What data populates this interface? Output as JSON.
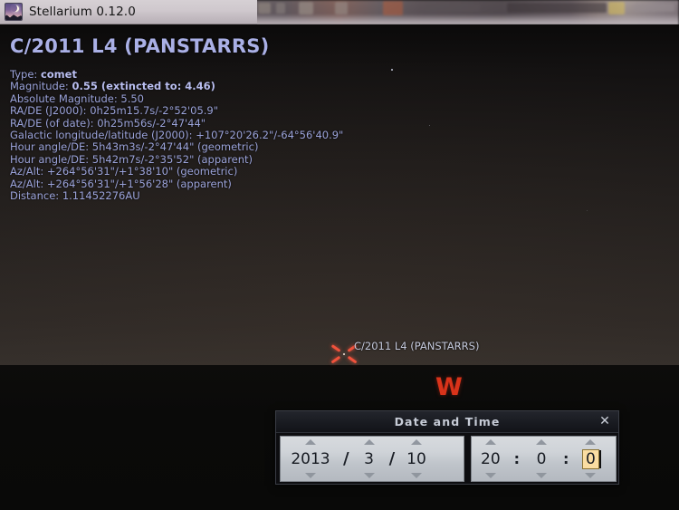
{
  "window": {
    "title": "Stellarium 0.12.0",
    "icon": "stellarium-moon-icon"
  },
  "info_panel": {
    "object_name": "C/2011 L4 (PANSTARRS)",
    "lines": [
      {
        "label": "Type:",
        "value": "comet"
      },
      {
        "label": "Magnitude:",
        "value": "0.55 (extincted to: 4.46)"
      },
      {
        "label": "Absolute Magnitude:",
        "value": "5.50"
      },
      {
        "label": "RA/DE (J2000):",
        "value": "0h25m15.7s/-2°52'05.9\""
      },
      {
        "label": "RA/DE (of date):",
        "value": "0h25m56s/-2°47'44\""
      },
      {
        "label": "Galactic longitude/latitude (J2000):",
        "value": "+107°20'26.2\"/-64°56'40.9\""
      },
      {
        "label": "Hour angle/DE:",
        "value": "5h43m3s/-2°47'44\" (geometric)"
      },
      {
        "label": "Hour angle/DE:",
        "value": "5h42m7s/-2°35'52\" (apparent)"
      },
      {
        "label": "Az/Alt:",
        "value": "+264°56'31\"/+1°38'10\" (geometric)"
      },
      {
        "label": "Az/Alt:",
        "value": "+264°56'31\"/+1°56'28\" (apparent)"
      },
      {
        "label": "Distance:",
        "value": "1.11452276AU"
      }
    ]
  },
  "sky": {
    "comet_label": "C/2011 L4 (PANSTARRS)",
    "cardinal_west": "W",
    "selection_marker_color": "#f0523c",
    "cardinal_color": "#d9331a"
  },
  "dialog": {
    "title": "Date and Time",
    "close_label": "✕",
    "date": {
      "year": "2013",
      "month": "3",
      "day": "10",
      "separator": "/"
    },
    "time": {
      "hour": "20",
      "minute": "0",
      "second": "0",
      "separator": ":"
    },
    "selected_field": "second",
    "highlight_color": "#fadda2"
  }
}
